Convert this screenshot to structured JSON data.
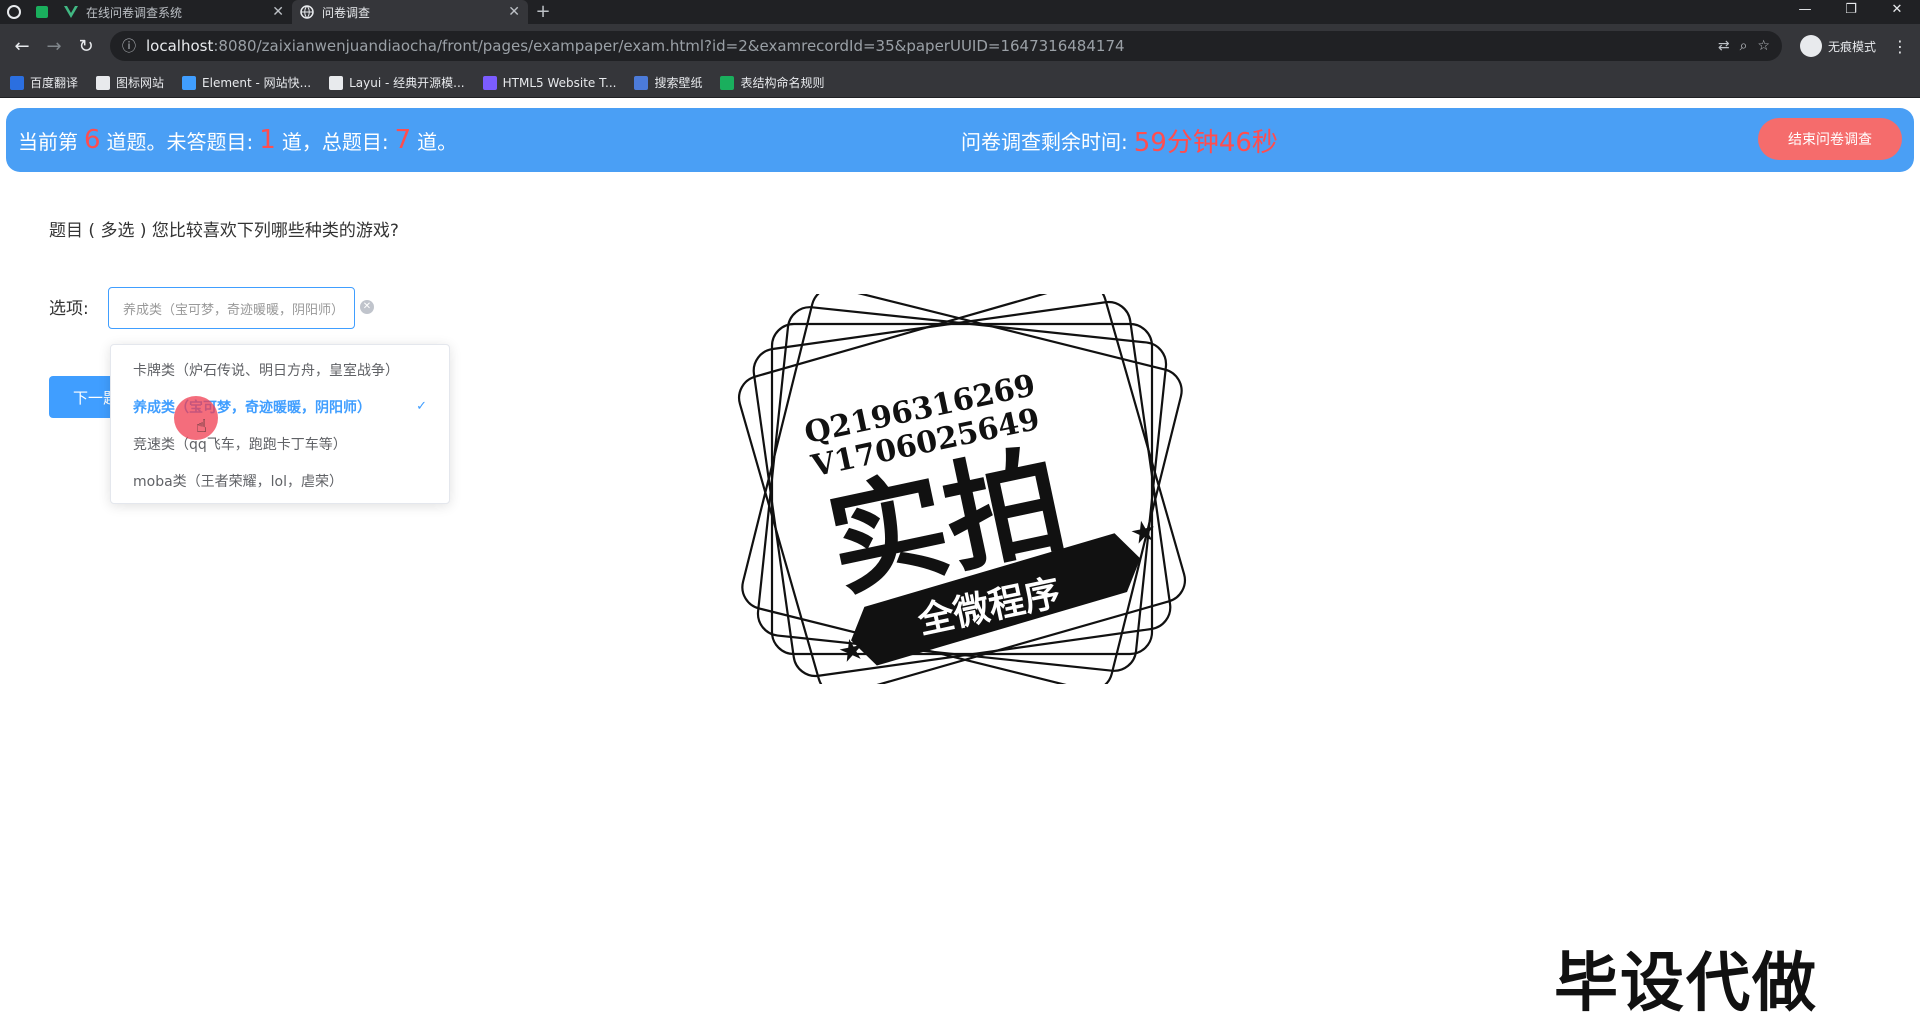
{
  "browser": {
    "tabs": [
      {
        "title": "在线问卷调查系统",
        "active": false
      },
      {
        "title": "问卷调查",
        "active": true
      }
    ],
    "new_tab": "+",
    "url_host": "localhost",
    "url_rest": ":8080/zaixianwenjuandiaocha/front/pages/exampaper/exam.html?id=2&examrecordId=35&paperUUID=1647316484174",
    "profile_label": "无痕模式",
    "bookmarks": [
      {
        "label": "百度翻译",
        "color": "#2b6fe0"
      },
      {
        "label": "图标网站",
        "color": "#e8eaed"
      },
      {
        "label": "Element - 网站快...",
        "color": "#409eff"
      },
      {
        "label": "Layui - 经典开源模...",
        "color": "#e8eaed"
      },
      {
        "label": "HTML5 Website T...",
        "color": "#7b5cff"
      },
      {
        "label": "搜索壁纸",
        "color": "#4c7bd9"
      },
      {
        "label": "表结构命名规则",
        "color": "#1aaf5d"
      }
    ]
  },
  "banner": {
    "current_prefix": "当前第",
    "current_num": "6",
    "current_suffix": "道题。未答题目:",
    "unanswered_num": "1",
    "unanswered_suffix": "道，总题目:",
    "total_num": "7",
    "total_suffix": "道。",
    "timer_label": "问卷调查剩余时间:",
    "timer_value": "59分钟46秒",
    "end_button": "结束问卷调查"
  },
  "question": {
    "text": "题目 ( 多选 ) 您比较喜欢下列哪些种类的游戏?",
    "options_label": "选项:",
    "select_value": "养成类（宝可梦，奇迹暖暖，阴阳师）",
    "next_button": "下一题",
    "options": [
      {
        "label": "卡牌类（炉石传说、明日方舟，皇室战争）",
        "selected": false
      },
      {
        "label": "养成类（宝可梦，奇迹暖暖，阴阳师）",
        "selected": true
      },
      {
        "label": "竞速类（qq飞车，跑跑卡丁车等）",
        "selected": false
      },
      {
        "label": "moba类（王者荣耀，lol，虐荣）",
        "selected": false
      }
    ]
  },
  "watermark": {
    "line1": "Q2196316269",
    "line2": "V1706025649",
    "big": "实拍",
    "ribbon": "全微程序",
    "footer": "毕设代做"
  },
  "colors": {
    "banner": "#4a9ff5",
    "accent": "#409eff",
    "danger": "#f56c6c",
    "highlight_num": "#ff4d4f"
  }
}
